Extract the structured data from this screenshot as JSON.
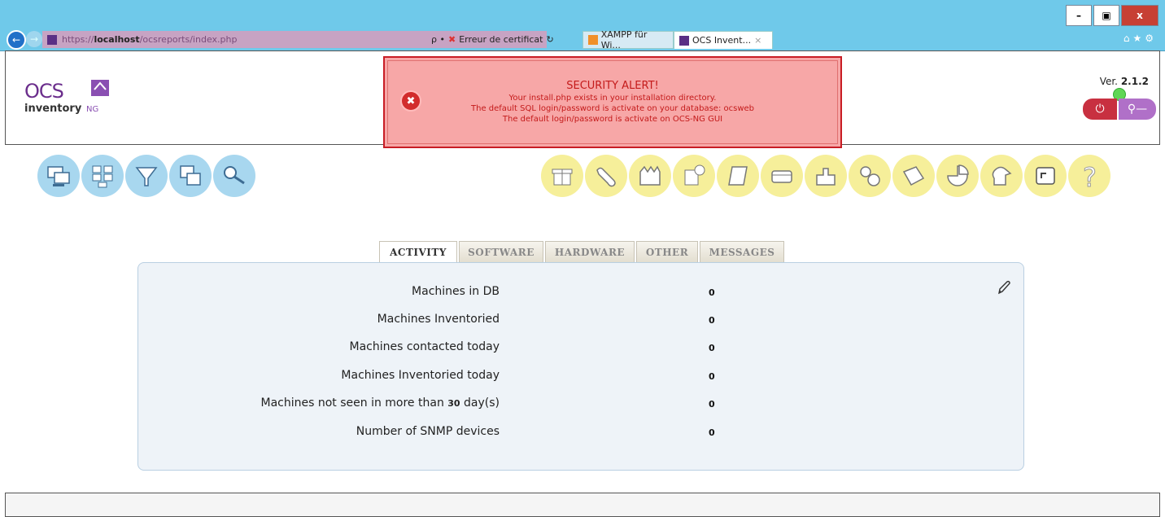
{
  "browser": {
    "url_scheme": "https://",
    "url_host": "localhost",
    "url_path": "/ocsreports/index.php",
    "search_glyph": "ρ •",
    "cert_error": "Erreur de certificat",
    "tabs": [
      {
        "label": "XAMPP für Wi..."
      },
      {
        "label": "OCS Invent...",
        "close": "×"
      }
    ],
    "window_controls": {
      "minimize": "–",
      "maximize": "▣",
      "close": "x"
    }
  },
  "header": {
    "logo": {
      "top": "OCS",
      "bottom": "inventory",
      "suffix": "NG"
    },
    "version_prefix": "Ver.",
    "version": "2.1.2"
  },
  "alert": {
    "title": "SECURITY ALERT!",
    "lines": [
      "Your install.php exists in your installation directory.",
      "The default SQL login/password is activate on your database: ocsweb",
      "The default login/password is activate on OCS-NG GUI"
    ]
  },
  "menu": {
    "left_icons": [
      "computers-icon",
      "groups-icon",
      "filter-icon",
      "duplicates-icon",
      "search-icon"
    ],
    "right_icons": [
      "deploy-icon",
      "config-icon",
      "network-icon",
      "snmp-icon",
      "dictionary-icon",
      "ipdiscover-icon",
      "download-icon",
      "plugins-icon",
      "registry-icon",
      "reports-icon",
      "users-icon",
      "console-icon",
      "help-icon"
    ]
  },
  "tabs": [
    "ACTIVITY",
    "SOFTWARE",
    "HARDWARE",
    "OTHER",
    "MESSAGES"
  ],
  "active_tab": "ACTIVITY",
  "stats": [
    {
      "label": "Machines in DB",
      "value": "0"
    },
    {
      "label": "Machines Inventoried",
      "value": "0"
    },
    {
      "label": "Machines contacted today",
      "value": "0"
    },
    {
      "label": "Machines Inventoried today",
      "value": "0"
    },
    {
      "label_pre": "Machines not seen in more than",
      "label_num": "30",
      "label_post": "day(s)",
      "value": "0"
    },
    {
      "label": "Number of SNMP devices",
      "value": "0"
    }
  ],
  "colors": {
    "chrome": "#6fc9ea",
    "alert_bg": "#f7a7a7",
    "alert_text": "#c41a1a",
    "menu_blue": "#a8d7ef",
    "menu_yellow": "#f6ef9a",
    "panel_bg": "#eef3f8"
  }
}
